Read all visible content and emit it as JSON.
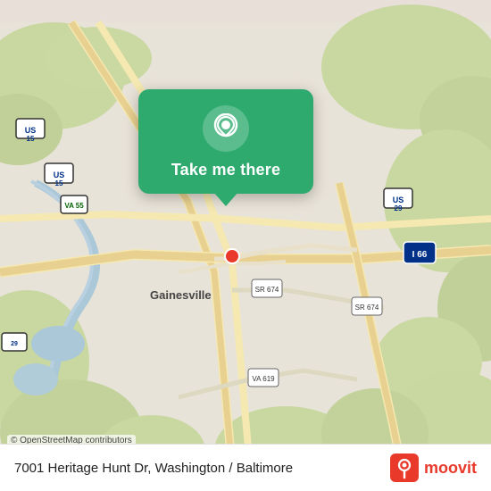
{
  "map": {
    "alt": "Map of Gainesville, VA area",
    "attribution": "© OpenStreetMap contributors"
  },
  "tooltip": {
    "label": "Take me there",
    "icon": "location-pin-icon"
  },
  "bottom_bar": {
    "address": "7001 Heritage Hunt Dr, Washington / Baltimore",
    "brand_name": "moovit"
  }
}
